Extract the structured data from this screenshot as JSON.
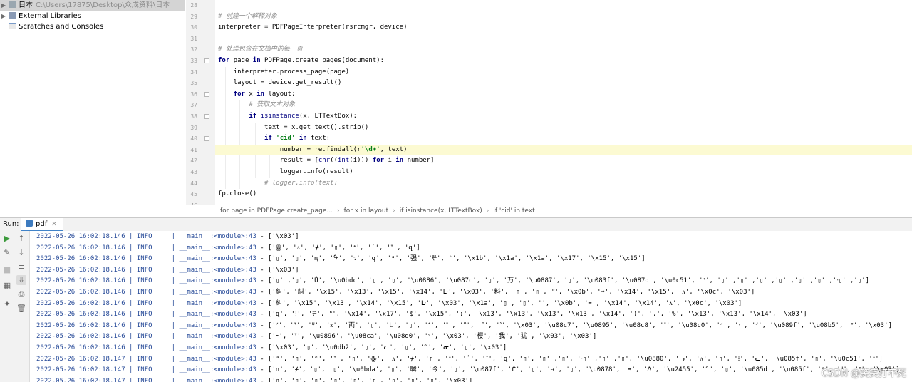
{
  "project_tree": {
    "items": [
      {
        "label": "日本",
        "path": "C:\\Users\\17875\\Desktop\\众成资料\\日本",
        "selected": true
      },
      {
        "label": "External Libraries",
        "path": ""
      },
      {
        "label": "Scratches and Consoles",
        "path": ""
      }
    ]
  },
  "editor": {
    "line_numbers": [
      "28",
      "29",
      "30",
      "31",
      "32",
      "33",
      "34",
      "35",
      "36",
      "37",
      "38",
      "39",
      "40",
      "41",
      "42",
      "43",
      "44",
      "45",
      "46"
    ],
    "lines": [
      "",
      "# 创建一个解释对象",
      "interpreter = PDFPageInterpreter(rsrcmgr, device)",
      "",
      "# 处理包含在文档中的每一页",
      "for page in PDFPage.create_pages(document):",
      "    interpreter.process_page(page)",
      "    layout = device.get_result()",
      "    for x in layout:",
      "        # 获取文本对象",
      "        if isinstance(x, LTTextBox):",
      "            text = x.get_text().strip()",
      "            if 'cid' in text:",
      "                number = re.findall(r'\\d+', text)",
      "                result = [chr((int(i))) for i in number]",
      "                logger.info(result)",
      "            # logger.info(text)",
      "fp.close()",
      ""
    ],
    "current_line_index": 13
  },
  "breadcrumb": {
    "items": [
      "for page in PDFPage.create_page...",
      "for x in layout",
      "if isinstance(x, LTTextBox)",
      "if 'cid' in text"
    ]
  },
  "run": {
    "label": "Run:",
    "tab_label": "pdf",
    "log_lines": [
      {
        "ts": "2022-05-26 16:02:18.146",
        "level": "INFO",
        "module": "__main__:<module>:43",
        "msg": "['\\x03']"
      },
      {
        "ts": "2022-05-26 16:02:18.146",
        "level": "INFO",
        "module": "__main__:<module>:43",
        "msg": "['ꙮ', 'ᴧ', 'ᚋ', '▯', 'ᐩ', '᾽', 'ᐪ', 'զ']"
      },
      {
        "ts": "2022-05-26 16:02:18.146",
        "level": "INFO",
        "module": "__main__:<module>:43",
        "msg": "['▯', '▯', 'ꞑ', 'ᠲ', 'ɂ', 'զ', 'ᵃ', '强', 'ᢟ', 'ᡃ', '\\x1b', '\\x1a', '\\x1a', '\\x17', '\\x15', '\\x15']"
      },
      {
        "ts": "2022-05-26 16:02:18.146",
        "level": "INFO",
        "module": "__main__:<module>:43",
        "msg": "['\\x03']"
      },
      {
        "ts": "2022-05-26 16:02:18.146",
        "level": "INFO",
        "module": "__main__:<module>:43",
        "msg": "['▯' ,'▯', 'Ů', '\\u0bdc', '▯', '▯', '\\u0886', '\\u087c', '▯', '万', '\\u0887', '▯', '\\u083f', '\\u087d', '\\u0c51', 'ᐩ', '▯' ,'▯' ,'▯' ,'▯' ,'▯' ,'▯' ,'ᐧ▯' ,'▯']"
      },
      {
        "ts": "2022-05-26 16:02:18.146",
        "level": "INFO",
        "module": "__main__:<module>:43",
        "msg": "['糾', '糾', '\\x15', '\\x13', '\\x15', '\\x14', 'ᒷ', '\\x03', '料', '▯', '▯', 'ᡃ', '\\x0b', '➡', '\\x14', '\\x15', 'ᴧ', '\\x0c', '\\x03']"
      },
      {
        "ts": "2022-05-26 16:02:18.146",
        "level": "INFO",
        "module": "__main__:<module>:43",
        "msg": "['糾', '\\x15', '\\x13', '\\x14', '\\x15', 'ᒷ', '\\x03', '\\x1a', '▯', '▯', 'ᡃ', '\\x0b', '➡', '\\x14', '\\x14', 'ᴧ', '\\x0c', '\\x03']"
      },
      {
        "ts": "2022-05-26 16:02:18.146",
        "level": "INFO",
        "module": "__main__:<module>:43",
        "msg": "['զ', '⁞', 'ᢟ', 'ᡃ', '\\x14', '\\x17', '$', '\\x15', ';', '\\x13', '\\x13', '\\x13', '\\x13', '\\x14', ')', ',', '%', '\\x13', '\\x13', '\\x14', '\\x03']"
      },
      {
        "ts": "2022-05-26 16:02:18.146",
        "level": "INFO",
        "module": "__main__:<module>:43",
        "msg": "['ᐟ', 'ᐪ', 'ᓑ', 'ᴢ', '両', '▯', 'ᘂ', '▯', 'ᐩ', 'ᐦ', 'ᐤ', 'ᐪ', 'ᐣ', '\\x03', '\\u08c7', '\\u0895', '\\u08c8', 'ᐪ', '\\u08c0', 'ᐟ', 'ᐧ', 'ᐟ', '\\u089f', '\\u08b5', 'ᐤ', '\\x03']"
      },
      {
        "ts": "2022-05-26 16:02:18.146",
        "level": "INFO",
        "module": "__main__:<module>:43",
        "msg": "['⁃', 'ᐪ', '\\u0896', '\\u08ca', '\\u08d0', 'ᐤ', '\\x03', '樱', '我', '犹', '\\x03', '\\x03']"
      },
      {
        "ts": "2022-05-26 16:02:18.146",
        "level": "INFO",
        "module": "__main__:<module>:43",
        "msg": "['\\x03', '▯', '\\u0db2', '▯', 'ᓚ', '▯', 'ᓐ', 'ᓂ', '▯', '\\x03']"
      },
      {
        "ts": "2022-05-26 16:02:18.147",
        "level": "INFO",
        "module": "__main__:<module>:43",
        "msg": "['ᵃ', '▯', 'ᵉ', 'ᐪ', '▯', 'ꙮ', 'ᴧ', 'ᚋ', '▯', 'ᐩ', '᾽', 'ᐪ', 'զ', '▯', '▯' ,'▯', 'ᐧ▯' ,'▯' ,'▯', '\\u0880', 'ᓓ', 'ᴧ', '▯', '⁞', 'ᓚ', '\\u085f', '▯', '\\u0c51', 'ᐩ']"
      },
      {
        "ts": "2022-05-26 16:02:18.147",
        "level": "INFO",
        "module": "__main__:<module>:43",
        "msg": "['ꞑ', 'ᚋ', '▯', '▯', '\\u0bda', '▯', '瞬', '今', '▯', '\\u087f', 'ᒋ', '▯', '⇢', '▯', '\\u0878', '➡', 'ᐱ', '\\u2455', 'ᓐ', '▯', '\\u085d', '\\u085f', 'ᵃ', 'ᐦ', 'ᐤ', '\\x03']"
      },
      {
        "ts": "2022-05-26 16:02:18.147",
        "level": "INFO",
        "module": "__main__:<module>:43",
        "msg": "['▯', '▯', '▯', '▯', '▯', '▯', '▯', '▯', '▯', '\\x03']"
      }
    ]
  },
  "watermark": "CSDN @笑笑打不死"
}
